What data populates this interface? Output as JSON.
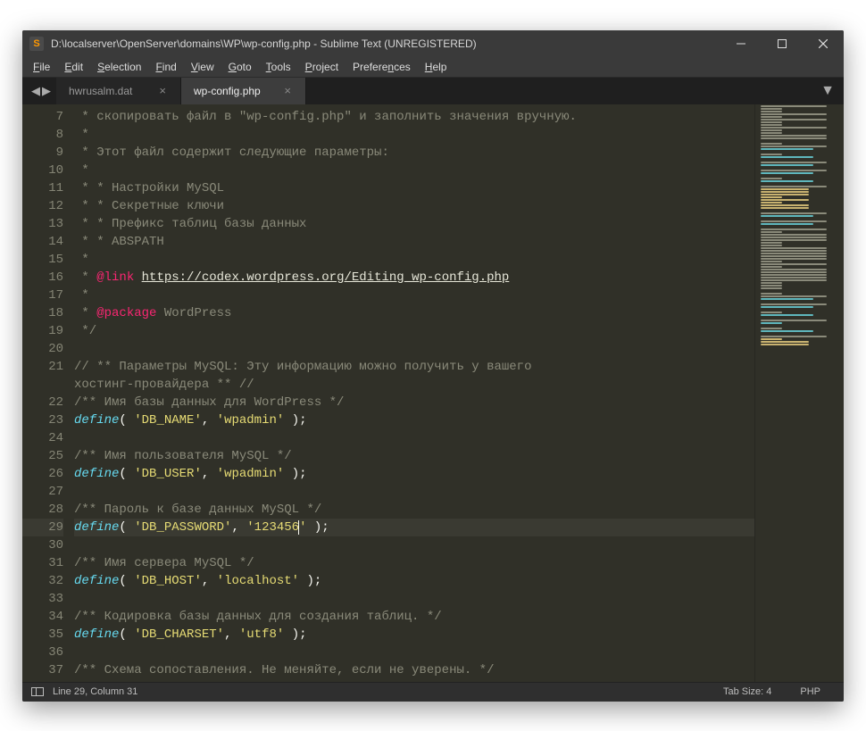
{
  "window": {
    "title": "D:\\localserver\\OpenServer\\domains\\WP\\wp-config.php - Sublime Text (UNREGISTERED)"
  },
  "menu": {
    "file": "File",
    "edit": "Edit",
    "selection": "Selection",
    "find": "Find",
    "view": "View",
    "goto": "Goto",
    "tools": "Tools",
    "project": "Project",
    "preferences": "Preferences",
    "help": "Help"
  },
  "tabs": [
    {
      "label": "hwrusalm.dat",
      "active": false
    },
    {
      "label": "wp-config.php",
      "active": true
    }
  ],
  "status": {
    "position": "Line 29, Column 31",
    "tabsize": "Tab Size: 4",
    "syntax": "PHP"
  },
  "editor": {
    "first_line": 7,
    "current_line": 29,
    "lines": [
      {
        "n": 7,
        "segs": [
          {
            "t": " * скопировать файл в \"wp-config.php\" и заполнить значения вручную.",
            "c": "c-comment"
          }
        ]
      },
      {
        "n": 8,
        "segs": [
          {
            "t": " *",
            "c": "c-comment"
          }
        ]
      },
      {
        "n": 9,
        "segs": [
          {
            "t": " * Этот файл содержит следующие параметры:",
            "c": "c-comment"
          }
        ]
      },
      {
        "n": 10,
        "segs": [
          {
            "t": " *",
            "c": "c-comment"
          }
        ]
      },
      {
        "n": 11,
        "segs": [
          {
            "t": " * * Настройки MySQL",
            "c": "c-comment"
          }
        ]
      },
      {
        "n": 12,
        "segs": [
          {
            "t": " * * Секретные ключи",
            "c": "c-comment"
          }
        ]
      },
      {
        "n": 13,
        "segs": [
          {
            "t": " * * Префикс таблиц базы данных",
            "c": "c-comment"
          }
        ]
      },
      {
        "n": 14,
        "segs": [
          {
            "t": " * * ABSPATH",
            "c": "c-comment"
          }
        ]
      },
      {
        "n": 15,
        "segs": [
          {
            "t": " *",
            "c": "c-comment"
          }
        ]
      },
      {
        "n": 16,
        "segs": [
          {
            "t": " * ",
            "c": "c-comment"
          },
          {
            "t": "@link",
            "c": "c-tag"
          },
          {
            "t": " ",
            "c": "c-comment"
          },
          {
            "t": "https://codex.wordpress.org/Editing_wp-config.php",
            "c": "c-link"
          }
        ]
      },
      {
        "n": 17,
        "segs": [
          {
            "t": " *",
            "c": "c-comment"
          }
        ]
      },
      {
        "n": 18,
        "segs": [
          {
            "t": " * ",
            "c": "c-comment"
          },
          {
            "t": "@package",
            "c": "c-tag"
          },
          {
            "t": " WordPress",
            "c": "c-comment"
          }
        ]
      },
      {
        "n": 19,
        "segs": [
          {
            "t": " */",
            "c": "c-comment"
          }
        ]
      },
      {
        "n": 20,
        "segs": [
          {
            "t": "",
            "c": ""
          }
        ]
      },
      {
        "n": 21,
        "segs": [
          {
            "t": "// ** Параметры MySQL: Эту информацию можно получить у вашего хостинг-провайдера ** //",
            "c": "c-comment"
          }
        ],
        "wrap": true
      },
      {
        "n": 22,
        "segs": [
          {
            "t": "/** Имя базы данных для WordPress */",
            "c": "c-comment"
          }
        ]
      },
      {
        "n": 23,
        "segs": [
          {
            "t": "define",
            "c": "c-keyword"
          },
          {
            "t": "( ",
            "c": "c-punct"
          },
          {
            "t": "'DB_NAME'",
            "c": "c-string"
          },
          {
            "t": ", ",
            "c": "c-punct"
          },
          {
            "t": "'wpadmin'",
            "c": "c-string"
          },
          {
            "t": " );",
            "c": "c-punct"
          }
        ]
      },
      {
        "n": 24,
        "segs": [
          {
            "t": "",
            "c": ""
          }
        ]
      },
      {
        "n": 25,
        "segs": [
          {
            "t": "/** Имя пользователя MySQL */",
            "c": "c-comment"
          }
        ]
      },
      {
        "n": 26,
        "segs": [
          {
            "t": "define",
            "c": "c-keyword"
          },
          {
            "t": "( ",
            "c": "c-punct"
          },
          {
            "t": "'DB_USER'",
            "c": "c-string"
          },
          {
            "t": ", ",
            "c": "c-punct"
          },
          {
            "t": "'wpadmin'",
            "c": "c-string"
          },
          {
            "t": " );",
            "c": "c-punct"
          }
        ]
      },
      {
        "n": 27,
        "segs": [
          {
            "t": "",
            "c": ""
          }
        ]
      },
      {
        "n": 28,
        "segs": [
          {
            "t": "/** Пароль к базе данных MySQL */",
            "c": "c-comment"
          }
        ]
      },
      {
        "n": 29,
        "segs": [
          {
            "t": "define",
            "c": "c-keyword"
          },
          {
            "t": "( ",
            "c": "c-punct"
          },
          {
            "t": "'DB_PASSWORD'",
            "c": "c-string"
          },
          {
            "t": ", ",
            "c": "c-punct"
          },
          {
            "t": "'123456",
            "c": "c-string"
          },
          {
            "t": "",
            "caret": true
          },
          {
            "t": "'",
            "c": "c-string"
          },
          {
            "t": " );",
            "c": "c-punct"
          }
        ]
      },
      {
        "n": 30,
        "segs": [
          {
            "t": "",
            "c": ""
          }
        ]
      },
      {
        "n": 31,
        "segs": [
          {
            "t": "/** Имя сервера MySQL */",
            "c": "c-comment"
          }
        ]
      },
      {
        "n": 32,
        "segs": [
          {
            "t": "define",
            "c": "c-keyword"
          },
          {
            "t": "( ",
            "c": "c-punct"
          },
          {
            "t": "'DB_HOST'",
            "c": "c-string"
          },
          {
            "t": ", ",
            "c": "c-punct"
          },
          {
            "t": "'localhost'",
            "c": "c-string"
          },
          {
            "t": " );",
            "c": "c-punct"
          }
        ]
      },
      {
        "n": 33,
        "segs": [
          {
            "t": "",
            "c": ""
          }
        ]
      },
      {
        "n": 34,
        "segs": [
          {
            "t": "/** Кодировка базы данных для создания таблиц. */",
            "c": "c-comment"
          }
        ]
      },
      {
        "n": 35,
        "segs": [
          {
            "t": "define",
            "c": "c-keyword"
          },
          {
            "t": "( ",
            "c": "c-punct"
          },
          {
            "t": "'DB_CHARSET'",
            "c": "c-string"
          },
          {
            "t": ", ",
            "c": "c-punct"
          },
          {
            "t": "'utf8'",
            "c": "c-string"
          },
          {
            "t": " );",
            "c": "c-punct"
          }
        ]
      },
      {
        "n": 36,
        "segs": [
          {
            "t": "",
            "c": ""
          }
        ]
      },
      {
        "n": 37,
        "segs": [
          {
            "t": "/** Схема сопоставления. Не меняйте, если не уверены. */",
            "c": "c-comment"
          }
        ]
      }
    ]
  }
}
